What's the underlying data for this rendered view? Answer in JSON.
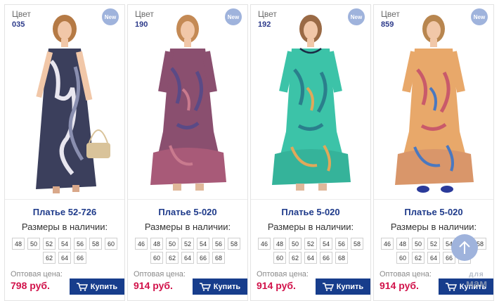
{
  "products": [
    {
      "color_label": "Цвет",
      "color_code": "035",
      "badge": "New",
      "title": "Платье 52-726",
      "sizes_label": "Размеры в наличии:",
      "sizes": [
        "48",
        "50",
        "52",
        "54",
        "56",
        "58",
        "60",
        "62",
        "64",
        "66"
      ],
      "price_label": "Оптовая цена:",
      "price": "798 руб.",
      "buy_label": "Купить",
      "dress_colors": [
        "#3b3f5c",
        "#e8e6ef",
        "#8a8fb0"
      ]
    },
    {
      "color_label": "Цвет",
      "color_code": "190",
      "badge": "New",
      "title": "Платье 5-020",
      "sizes_label": "Размеры в наличии:",
      "sizes": [
        "46",
        "48",
        "50",
        "52",
        "54",
        "56",
        "58",
        "60",
        "62",
        "64",
        "66",
        "68"
      ],
      "price_label": "Оптовая цена:",
      "price": "914 руб.",
      "buy_label": "Купить",
      "dress_colors": [
        "#8a4f6f",
        "#5a4a86",
        "#c97a8e"
      ]
    },
    {
      "color_label": "Цвет",
      "color_code": "192",
      "badge": "New",
      "title": "Платье 5-020",
      "sizes_label": "Размеры в наличии:",
      "sizes": [
        "46",
        "48",
        "50",
        "52",
        "54",
        "56",
        "58",
        "60",
        "62",
        "64",
        "66",
        "68"
      ],
      "price_label": "Оптовая цена:",
      "price": "914 руб.",
      "buy_label": "Купить",
      "dress_colors": [
        "#3cc3a8",
        "#2a7f8c",
        "#e0a85a"
      ]
    },
    {
      "color_label": "Цвет",
      "color_code": "859",
      "badge": "New",
      "title": "Платье 5-020",
      "sizes_label": "Размеры в наличии:",
      "sizes": [
        "46",
        "48",
        "50",
        "52",
        "54",
        "56",
        "58",
        "60",
        "62",
        "64",
        "66",
        "68"
      ],
      "price_label": "Оптовая цена:",
      "price": "914 руб.",
      "buy_label": "Купить",
      "dress_colors": [
        "#e8a86a",
        "#c95a6a",
        "#4a78c0"
      ]
    }
  ],
  "scroll_top_icon": "arrow-up-icon",
  "watermark": {
    "line1": "для",
    "line2": "мам"
  },
  "colors": {
    "accent": "#173d8c",
    "price": "#d1124a",
    "title": "#1e3a8a",
    "badge": "#9fb3dc"
  }
}
